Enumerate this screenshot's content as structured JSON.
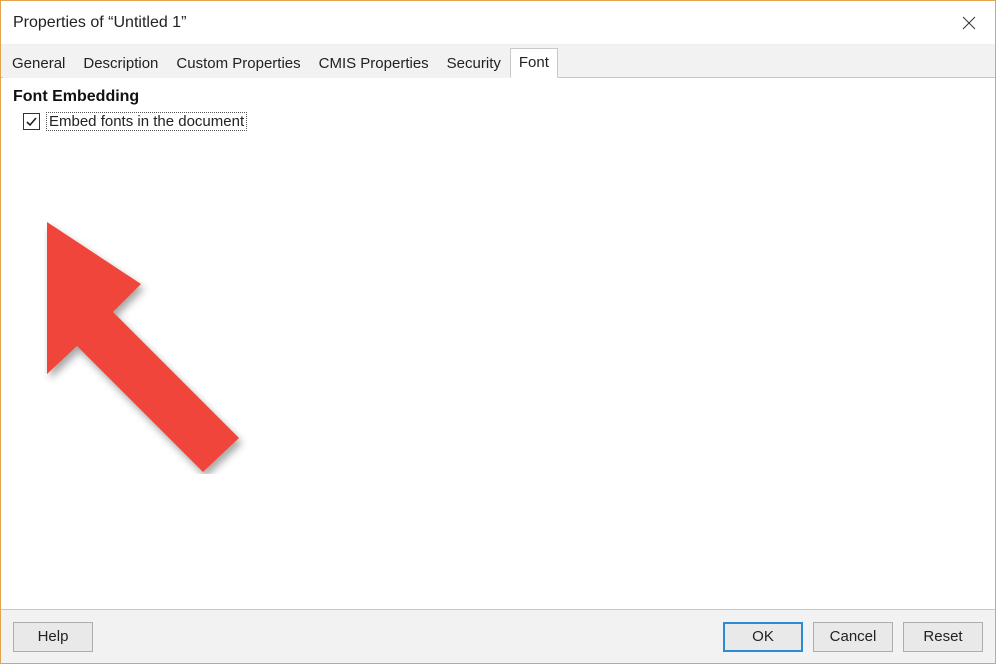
{
  "window": {
    "title": "Properties of “Untitled 1”"
  },
  "tabs": [
    {
      "label": "General",
      "active": false
    },
    {
      "label": "Description",
      "active": false
    },
    {
      "label": "Custom Properties",
      "active": false
    },
    {
      "label": "CMIS Properties",
      "active": false
    },
    {
      "label": "Security",
      "active": false
    },
    {
      "label": "Font",
      "active": true
    }
  ],
  "content": {
    "section_heading": "Font Embedding",
    "embed_checkbox": {
      "label": "Embed fonts in the document",
      "checked": true
    }
  },
  "footer": {
    "help": "Help",
    "ok": "OK",
    "cancel": "Cancel",
    "reset": "Reset"
  }
}
